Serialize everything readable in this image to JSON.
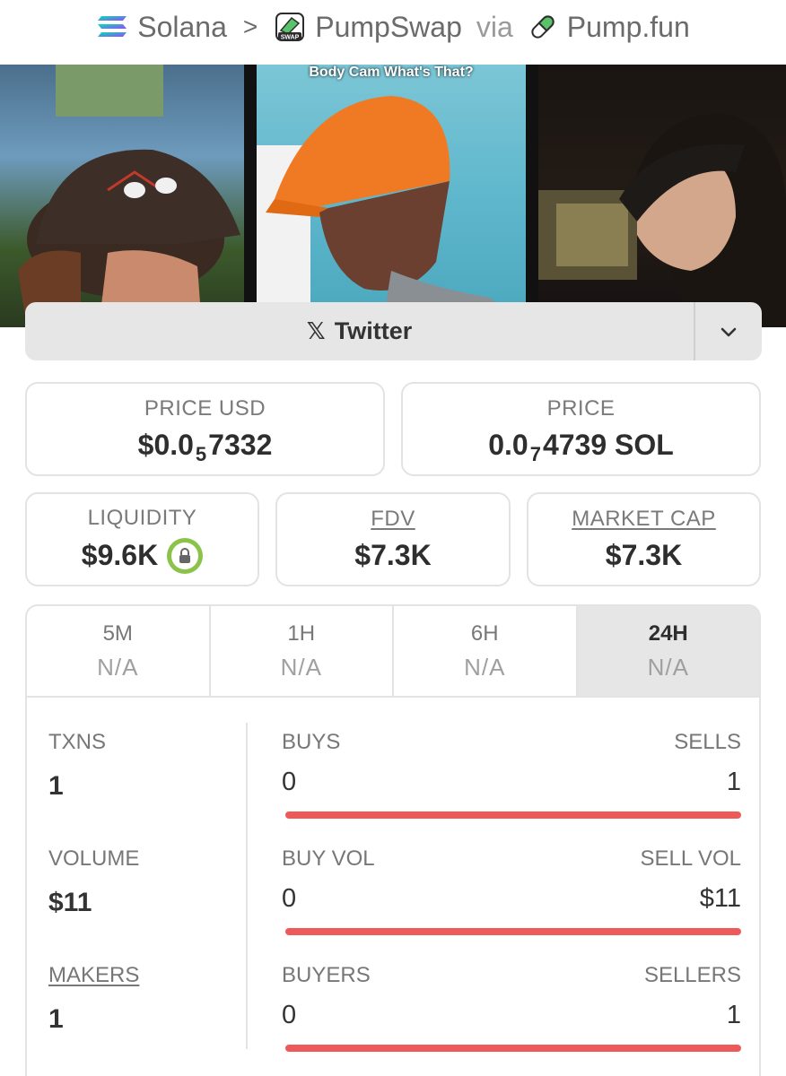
{
  "breadcrumb": {
    "chain": "Solana",
    "separator": ">",
    "dex": "PumpSwap",
    "via": "via",
    "launchpad": "Pump.fun",
    "swap_logo_text": "SWAP"
  },
  "banner": {
    "caption": "Body Cam What's That?"
  },
  "social": {
    "x_glyph": "𝕏",
    "label": "Twitter"
  },
  "price": {
    "usd_label": "PRICE USD",
    "usd_prefix": "$0.0",
    "usd_zeros": "5",
    "usd_digits": "7332",
    "native_label": "PRICE",
    "native_prefix": "0.0",
    "native_zeros": "7",
    "native_digits": "4739 SOL"
  },
  "metrics": {
    "liquidity_label": "LIQUIDITY",
    "liquidity_value": "$9.6K",
    "fdv_label": "FDV",
    "fdv_value": "$7.3K",
    "mcap_label": "MARKET CAP",
    "mcap_value": "$7.3K"
  },
  "timeframes": [
    {
      "label": "5M",
      "value": "N/A"
    },
    {
      "label": "1H",
      "value": "N/A"
    },
    {
      "label": "6H",
      "value": "N/A"
    },
    {
      "label": "24H",
      "value": "N/A"
    }
  ],
  "stats": {
    "txns_label": "TXNS",
    "txns_value": "1",
    "volume_label": "VOLUME",
    "volume_value": "$11",
    "makers_label": "MAKERS",
    "makers_value": "1",
    "buys_label": "BUYS",
    "buys_value": "0",
    "sells_label": "SELLS",
    "sells_value": "1",
    "buy_vol_label": "BUY VOL",
    "buy_vol_value": "0",
    "sell_vol_label": "SELL VOL",
    "sell_vol_value": "$11",
    "buyers_label": "BUYERS",
    "buyers_value": "0",
    "sellers_label": "SELLERS",
    "sellers_value": "1"
  },
  "colors": {
    "sell_bar": "#ee5a5a",
    "lock_green": "#8bc34a",
    "active_tab": "#e6e6e6"
  }
}
